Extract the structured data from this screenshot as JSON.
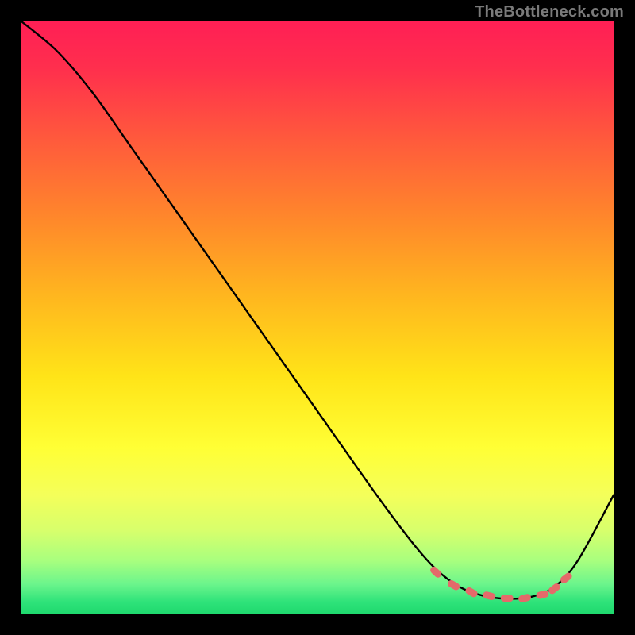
{
  "watermark": "TheBottleneck.com",
  "colors": {
    "frame_bg": "#000000",
    "curve": "#000000",
    "marker": "#e46a6a"
  },
  "chart_data": {
    "type": "line",
    "title": "",
    "xlabel": "",
    "ylabel": "",
    "xlim": [
      0,
      100
    ],
    "ylim": [
      0,
      100
    ],
    "grid": false,
    "legend": false,
    "series": [
      {
        "name": "curve",
        "x": [
          0,
          6,
          12,
          18,
          24,
          30,
          36,
          42,
          48,
          54,
          60,
          66,
          70,
          74,
          78,
          82,
          86,
          90,
          94,
          100
        ],
        "y": [
          100,
          95,
          88,
          79.5,
          71,
          62.5,
          54,
          45.5,
          37,
          28.5,
          20,
          12,
          7.5,
          4.5,
          3,
          2.5,
          2.8,
          4.5,
          9,
          20
        ]
      }
    ],
    "markers": {
      "name": "highlight-band",
      "x": [
        70,
        73,
        76,
        79,
        82,
        85,
        88,
        90,
        92
      ],
      "y": [
        7.0,
        4.8,
        3.6,
        3.0,
        2.6,
        2.6,
        3.2,
        4.2,
        6.0
      ]
    }
  }
}
